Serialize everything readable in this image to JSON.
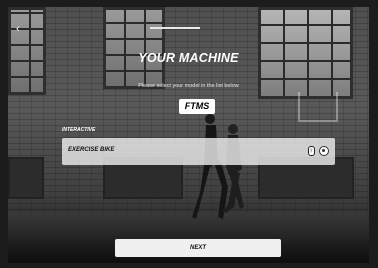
{
  "header": {
    "back_icon": "chevron-left-icon",
    "title": "YOUR MACHINE",
    "subtitle": "Please select your model in the list below"
  },
  "protocol_badge": {
    "label": "FTMS"
  },
  "machine_list": {
    "section_label": "INTERACTIVE",
    "items": [
      {
        "label": "EXERCISE BIKE",
        "connection_icon": "bluetooth-icon",
        "selected": true
      }
    ]
  },
  "footer": {
    "next_label": "NEXT"
  }
}
